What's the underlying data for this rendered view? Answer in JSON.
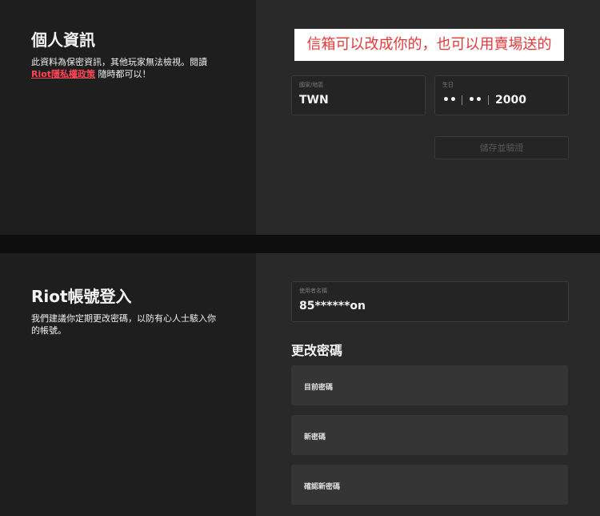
{
  "personal": {
    "title": "個人資訊",
    "desc_before": "此資料為保密資訊，其他玩家無法檢視。閱讀 ",
    "privacy_link": "Riot隱私權政策",
    "desc_after": " 隨時都可以！",
    "overlay_note": "信箱可以改成你的，也可以用賣場送的",
    "country_label": "國家/地區",
    "country_value": "TWN",
    "dob_label": "生日",
    "dob_month": "••",
    "dob_day": "••",
    "dob_year": "2000",
    "save_button": "儲存並驗證"
  },
  "account": {
    "title": "Riot帳號登入",
    "desc": "我們建議你定期更改密碼，以防有心人士駭入你的帳號。",
    "username_label": "使用者名稱",
    "username_value": "85******on",
    "change_password_title": "更改密碼",
    "current_password": "目前密碼",
    "new_password": "新密碼",
    "confirm_password": "確認新密碼"
  },
  "colors": {
    "accent": "#ff4655",
    "left_bg": "#1f1e1f",
    "right_bg": "#2a292a"
  }
}
